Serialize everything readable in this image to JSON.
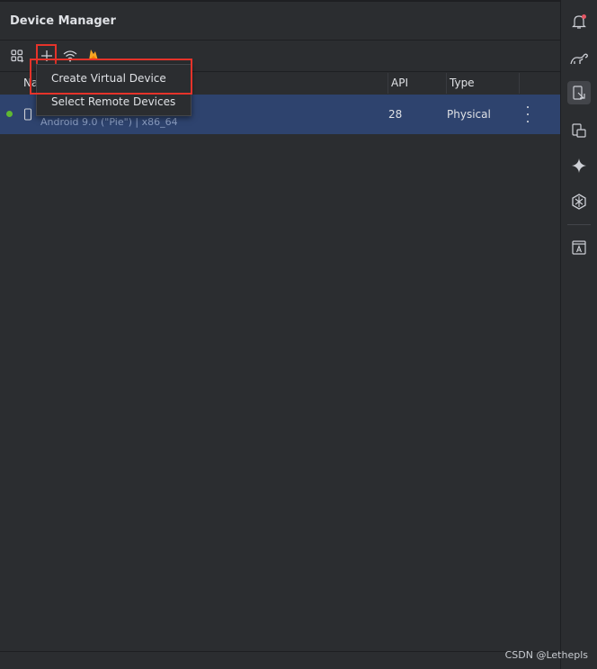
{
  "panel": {
    "title": "Device Manager"
  },
  "toolbar": {
    "icons": [
      "device-group-icon",
      "plus-icon",
      "wifi-pair-icon",
      "firebase-icon"
    ]
  },
  "table": {
    "columns": [
      "Na",
      "API",
      "Type"
    ],
    "rows": [
      {
        "status_color": "#5fb832",
        "subtitle": "Android 9.0 (\"Pie\") | x86_64",
        "api": "28",
        "type": "Physical"
      }
    ]
  },
  "menu": {
    "items": [
      "Create Virtual Device",
      "Select Remote Devices"
    ]
  },
  "right_toolbar": {
    "icons": [
      "notifications-icon",
      "gradle-icon",
      "device-manager-icon",
      "running-devices-icon",
      "gemini-icon",
      "app-quality-icon",
      "layout-inspector-icon"
    ]
  },
  "watermark": "CSDN @Lethepls",
  "colors": {
    "background": "#2b2d30",
    "selected_row": "#2e436e",
    "highlight": "#e5332a",
    "notification_badge": "#e55765"
  }
}
